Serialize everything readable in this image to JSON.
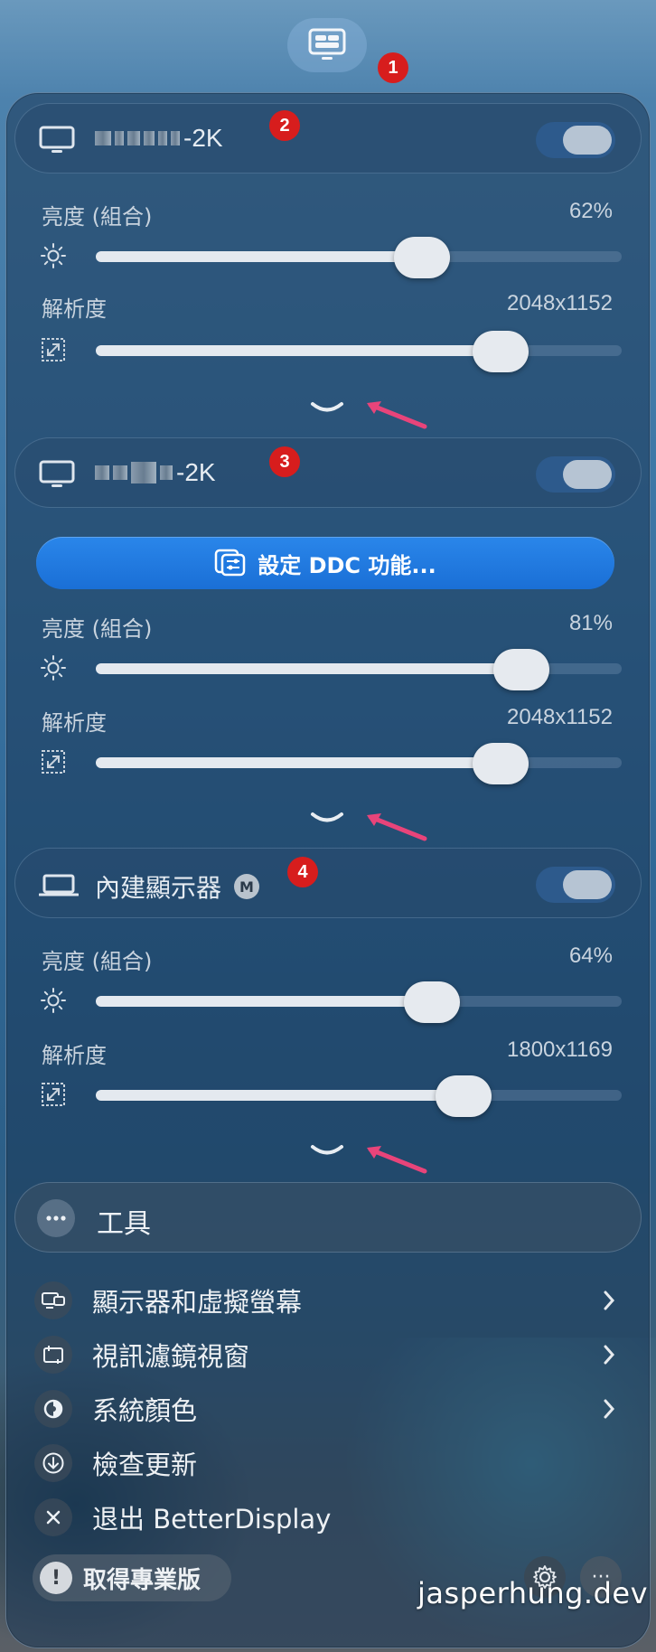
{
  "annotations": [
    "1",
    "2",
    "3",
    "4"
  ],
  "displays": [
    {
      "name_suffix": "-2K",
      "toggle_on": true,
      "brightness_label": "亮度 (組合)",
      "brightness_value": "62%",
      "brightness_fraction": 0.62,
      "resolution_label": "解析度",
      "resolution_value": "2048x1152",
      "resolution_fraction": 0.77
    },
    {
      "name_suffix": "-2K",
      "toggle_on": true,
      "ddc_button": "設定 DDC 功能...",
      "brightness_label": "亮度 (組合)",
      "brightness_value": "81%",
      "brightness_fraction": 0.81,
      "resolution_label": "解析度",
      "resolution_value": "2048x1152",
      "resolution_fraction": 0.77
    },
    {
      "name": "內建顯示器",
      "badge": "M",
      "toggle_on": true,
      "brightness_label": "亮度 (組合)",
      "brightness_value": "64%",
      "brightness_fraction": 0.64,
      "resolution_label": "解析度",
      "resolution_value": "1800x1169",
      "resolution_fraction": 0.7
    }
  ],
  "tools": {
    "title": "工具",
    "items": [
      {
        "label": "顯示器和虛擬螢幕",
        "icon": "displays-icon",
        "has_submenu": true
      },
      {
        "label": "視訊濾鏡視窗",
        "icon": "video-filter-icon",
        "has_submenu": true
      },
      {
        "label": "系統顏色",
        "icon": "color-icon",
        "has_submenu": true
      },
      {
        "label": "檢查更新",
        "icon": "download-icon",
        "has_submenu": false
      },
      {
        "label": "退出 BetterDisplay",
        "icon": "close-icon",
        "has_submenu": false
      }
    ]
  },
  "footer": {
    "pro_label": "取得專業版",
    "pro_icon_text": "!",
    "more_text": "···"
  },
  "watermark": "jasperhung.dev",
  "colors": {
    "accent": "#1a6fd6",
    "badge_red": "#d71d1d",
    "arrow_pink": "#e8447a"
  }
}
